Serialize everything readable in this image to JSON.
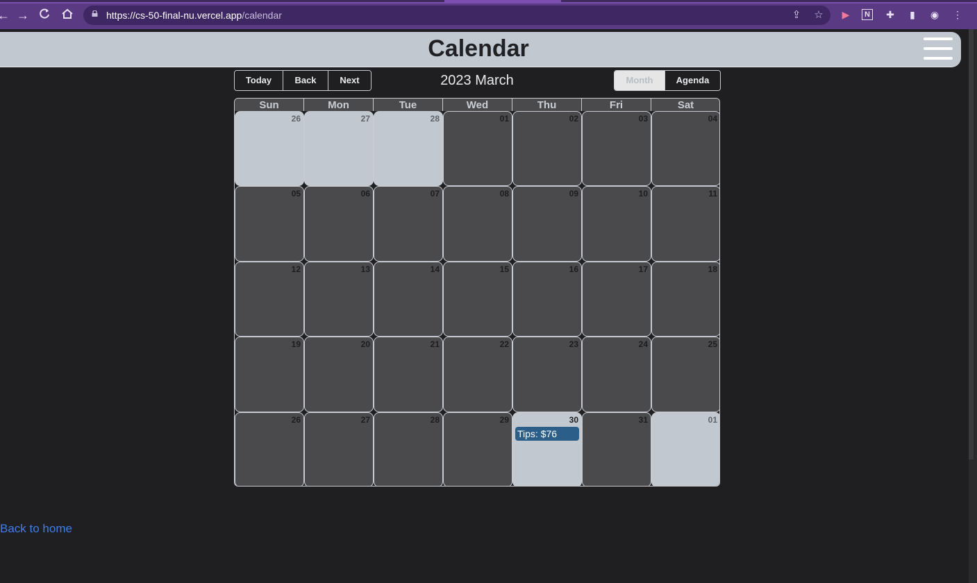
{
  "browser": {
    "url_host": "https://cs-50-final-nu.vercel.app",
    "url_path": "/calendar"
  },
  "app": {
    "title": "Calendar"
  },
  "toolbar": {
    "nav": [
      {
        "label": "Today"
      },
      {
        "label": "Back"
      },
      {
        "label": "Next"
      }
    ],
    "month_label": "2023 March",
    "views": [
      {
        "label": "Month",
        "active": true
      },
      {
        "label": "Agenda",
        "active": false
      }
    ]
  },
  "calendar": {
    "weekdays": [
      "Sun",
      "Mon",
      "Tue",
      "Wed",
      "Thu",
      "Fri",
      "Sat"
    ],
    "weeks": [
      [
        {
          "n": "26",
          "off": true
        },
        {
          "n": "27",
          "off": true
        },
        {
          "n": "28",
          "off": true
        },
        {
          "n": "01"
        },
        {
          "n": "02"
        },
        {
          "n": "03"
        },
        {
          "n": "04"
        }
      ],
      [
        {
          "n": "05"
        },
        {
          "n": "06"
        },
        {
          "n": "07"
        },
        {
          "n": "08"
        },
        {
          "n": "09"
        },
        {
          "n": "10"
        },
        {
          "n": "11"
        }
      ],
      [
        {
          "n": "12"
        },
        {
          "n": "13"
        },
        {
          "n": "14"
        },
        {
          "n": "15"
        },
        {
          "n": "16"
        },
        {
          "n": "17"
        },
        {
          "n": "18"
        }
      ],
      [
        {
          "n": "19"
        },
        {
          "n": "20"
        },
        {
          "n": "21"
        },
        {
          "n": "22"
        },
        {
          "n": "23"
        },
        {
          "n": "24"
        },
        {
          "n": "25"
        }
      ],
      [
        {
          "n": "26"
        },
        {
          "n": "27"
        },
        {
          "n": "28"
        },
        {
          "n": "29"
        },
        {
          "n": "30",
          "today": true,
          "event": "Tips: $76"
        },
        {
          "n": "31"
        },
        {
          "n": "01",
          "off": true
        }
      ]
    ]
  },
  "footer": {
    "back_link": "Back to home"
  },
  "colors": {
    "page_bg": "#1f1f21",
    "header_bg": "#c2c8d0",
    "day_bg": "#4a4a4c",
    "event_bg": "#2b5f8a",
    "link": "#3f7ee8"
  },
  "icons": [
    "back-arrow-icon",
    "forward-arrow-icon",
    "reload-icon",
    "home-icon",
    "lock-icon",
    "share-icon",
    "star-icon",
    "extension-icon",
    "notion-icon",
    "puzzle-icon",
    "sidepanel-icon",
    "profile-icon",
    "menu-dots-icon",
    "hamburger-menu-icon"
  ]
}
